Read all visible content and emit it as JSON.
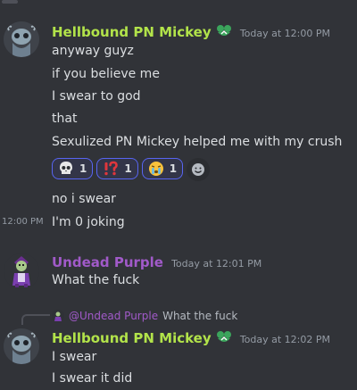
{
  "messages": [
    {
      "username": "Hellbound PN Mickey",
      "username_color": "#b2e34a",
      "timestamp": "Today at 12:00 PM",
      "lines": [
        "anyway guyz",
        "if you believe me",
        "I swear to god",
        "that",
        "Sexulized PN Mickey helped me with my crush"
      ],
      "reactions": [
        {
          "emoji": "skull-emoji",
          "count": "1"
        },
        {
          "emoji": "exclamation-question-emoji",
          "count": "1"
        },
        {
          "emoji": "crying-face-emoji",
          "count": "1"
        }
      ],
      "followups": [
        {
          "text": "no i swear",
          "hover_time": ""
        },
        {
          "text": "I'm 0 joking",
          "hover_time": "12:00 PM"
        }
      ]
    },
    {
      "username": "Undead Purple",
      "username_color": "#a15ac9",
      "timestamp": "Today at 12:01 PM",
      "lines": [
        "What the fuck"
      ]
    },
    {
      "reply_to_name": "@Undead Purple",
      "reply_to_text": "What the fuck",
      "username": "Hellbound PN Mickey",
      "username_color": "#b2e34a",
      "timestamp": "Today at 12:02 PM",
      "lines": [
        "I swear",
        "I swear it did"
      ]
    }
  ],
  "colors": {
    "background": "#313338",
    "reaction_border": "#5865f2",
    "badge_green": "#3ba55c",
    "reply_name": "#a15ac9"
  }
}
